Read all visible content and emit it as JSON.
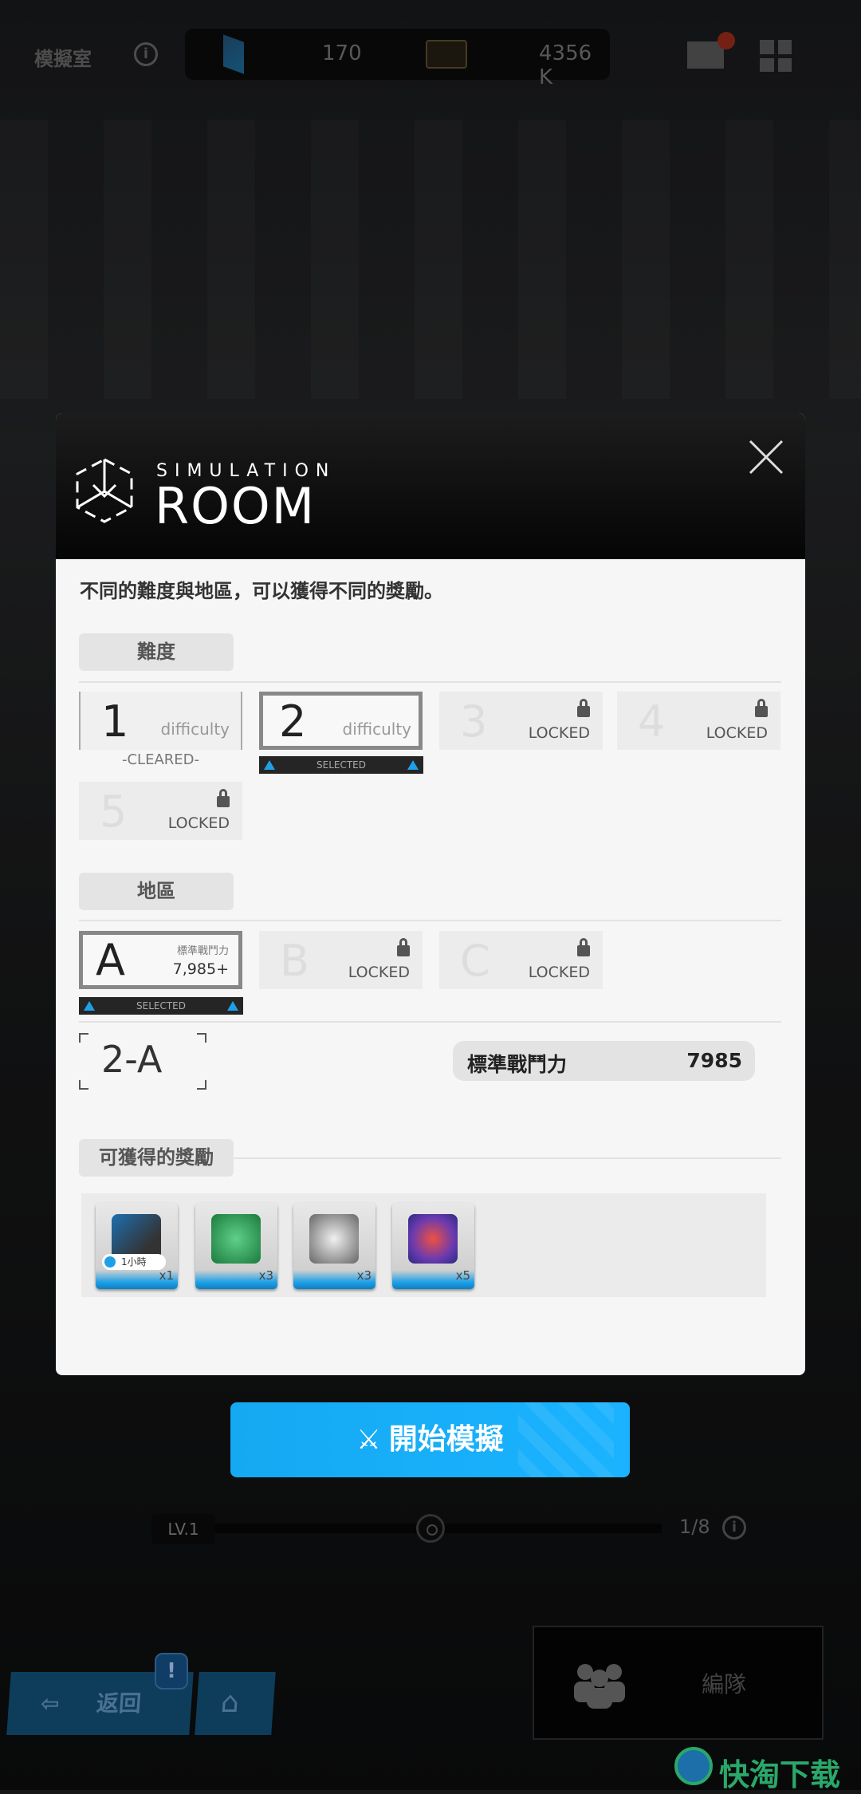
{
  "topbar": {
    "title": "模擬室",
    "resource1_value": "170",
    "resource2_value": "4356 K",
    "icons": [
      "info-icon",
      "crystal-icon",
      "chest-icon",
      "mail-icon",
      "menu-grid-icon"
    ],
    "mail_notification": true
  },
  "modal": {
    "logo_line1": "SIMULATION",
    "logo_line2": "ROOM",
    "description": "不同的難度與地區，可以獲得不同的獎勵。",
    "difficulty_label": "難度",
    "difficulties": [
      {
        "number": "1",
        "sub": "difficulty",
        "status": "-CLEARED-"
      },
      {
        "number": "2",
        "sub": "difficulty",
        "status": "SELECTED"
      },
      {
        "number": "3",
        "sub": "LOCKED"
      },
      {
        "number": "4",
        "sub": "LOCKED"
      },
      {
        "number": "5",
        "sub": "LOCKED"
      }
    ],
    "area_label": "地區",
    "areas": [
      {
        "letter": "A",
        "sub_label": "標準戰鬥力",
        "sub_value": "7,985+",
        "status": "SELECTED"
      },
      {
        "letter": "B",
        "sub": "LOCKED"
      },
      {
        "letter": "C",
        "sub": "LOCKED"
      }
    ],
    "stage": "2-A",
    "power_label": "標準戰鬥力",
    "power_value": "7985",
    "rewards_label": "可獲得的獎勵",
    "rewards": [
      {
        "name": "laptop",
        "badge": "1小時",
        "count": "x1"
      },
      {
        "name": "green-ore",
        "count": "x3"
      },
      {
        "name": "silver-ore",
        "count": "x3"
      },
      {
        "name": "rainbow-ore",
        "count": "x5"
      }
    ]
  },
  "start_button": "開始模擬",
  "level": {
    "label": "LV.1",
    "progress": "1/8"
  },
  "nav": {
    "back": "返回",
    "alert": "!",
    "formation": "編隊"
  },
  "watermark": "快淘下载",
  "colors": {
    "accent": "#1ea0e6",
    "start_button": "#18aef8"
  }
}
